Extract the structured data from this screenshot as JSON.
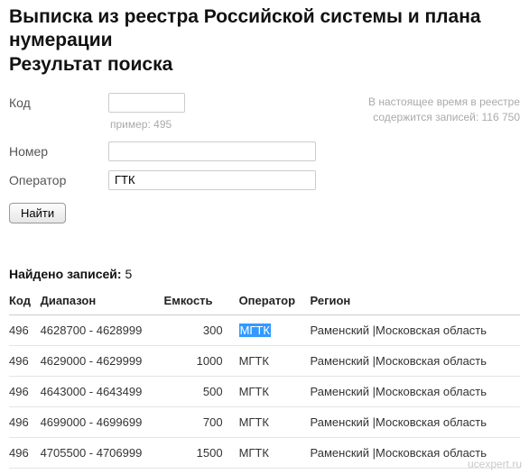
{
  "title_line1": "Выписка из реестра Российской системы и плана нумерации",
  "title_line2": "Результат поиска",
  "form": {
    "code_label": "Код",
    "code_value": "",
    "code_hint": "пример: 495",
    "number_label": "Номер",
    "number_value": "",
    "operator_label": "Оператор",
    "operator_value": "ГТК",
    "submit_label": "Найти"
  },
  "status": {
    "line1": "В настоящее время в реестре",
    "line2": "содержится записей: 116 750"
  },
  "results": {
    "found_label": "Найдено записей:",
    "found_count": "5",
    "columns": {
      "code": "Код",
      "range": "Диапазон",
      "capacity": "Емкость",
      "operator": "Оператор",
      "region": "Регион"
    },
    "rows": [
      {
        "code": "496",
        "range": "4628700 - 4628999",
        "capacity": "300",
        "operator": "МГТК",
        "region": "Раменский |Московская область",
        "highlight": true
      },
      {
        "code": "496",
        "range": "4629000 - 4629999",
        "capacity": "1000",
        "operator": "МГТК",
        "region": "Раменский |Московская область"
      },
      {
        "code": "496",
        "range": "4643000 - 4643499",
        "capacity": "500",
        "operator": "МГТК",
        "region": "Раменский |Московская область"
      },
      {
        "code": "496",
        "range": "4699000 - 4699699",
        "capacity": "700",
        "operator": "МГТК",
        "region": "Раменский |Московская область"
      },
      {
        "code": "496",
        "range": "4705500 - 4706999",
        "capacity": "1500",
        "operator": "МГТК",
        "region": "Раменский |Московская область"
      }
    ]
  },
  "watermark": "ucexpert.ru"
}
